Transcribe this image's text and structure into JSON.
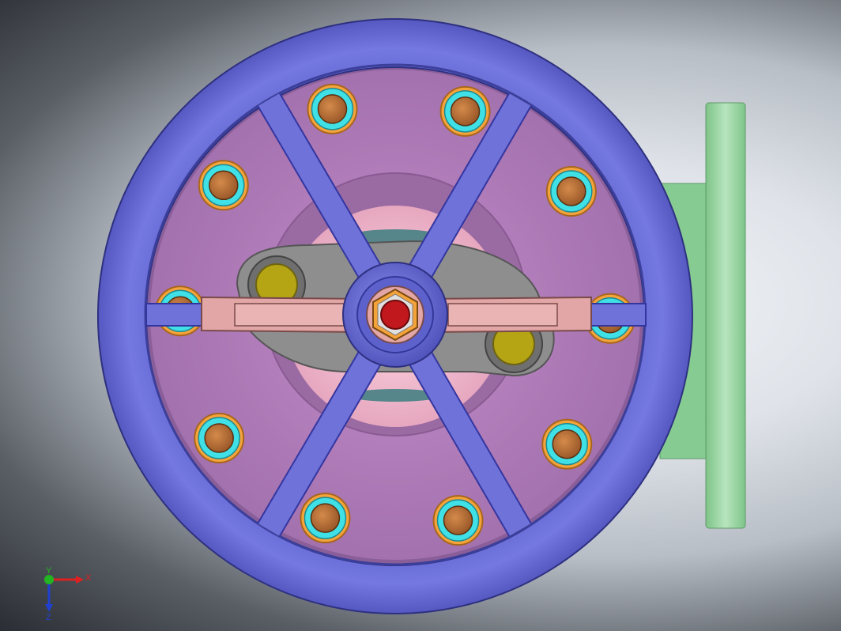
{
  "scene": {
    "description_free": true,
    "colors": {
      "background_light": "#eef1f5",
      "background_dark": "#2a2d33",
      "handwheel_rim": "#6b6fd8",
      "handwheel_spoke": "#6f72d9",
      "bonnet_plate": "#a574b0",
      "bonnet_hub": "#f2b8cc",
      "lever": "#e2a6a6",
      "yoke_bracket": "#8c8c8c",
      "body_flange": "#8fd19a",
      "bolt_nut_orange": "#f4a33b",
      "bolt_nut_cyan": "#3fe0e6",
      "bolt_head": "#c97a3e",
      "stem_nut_red": "#c0181c",
      "olive_cap": "#b5a514"
    },
    "bolt_count": 10,
    "spoke_count": 6
  },
  "triad": {
    "x_label": "X",
    "y_label": "Y",
    "z_label": "Z",
    "x_color": "#e02020",
    "y_color": "#22b422",
    "z_color": "#2040d0"
  }
}
